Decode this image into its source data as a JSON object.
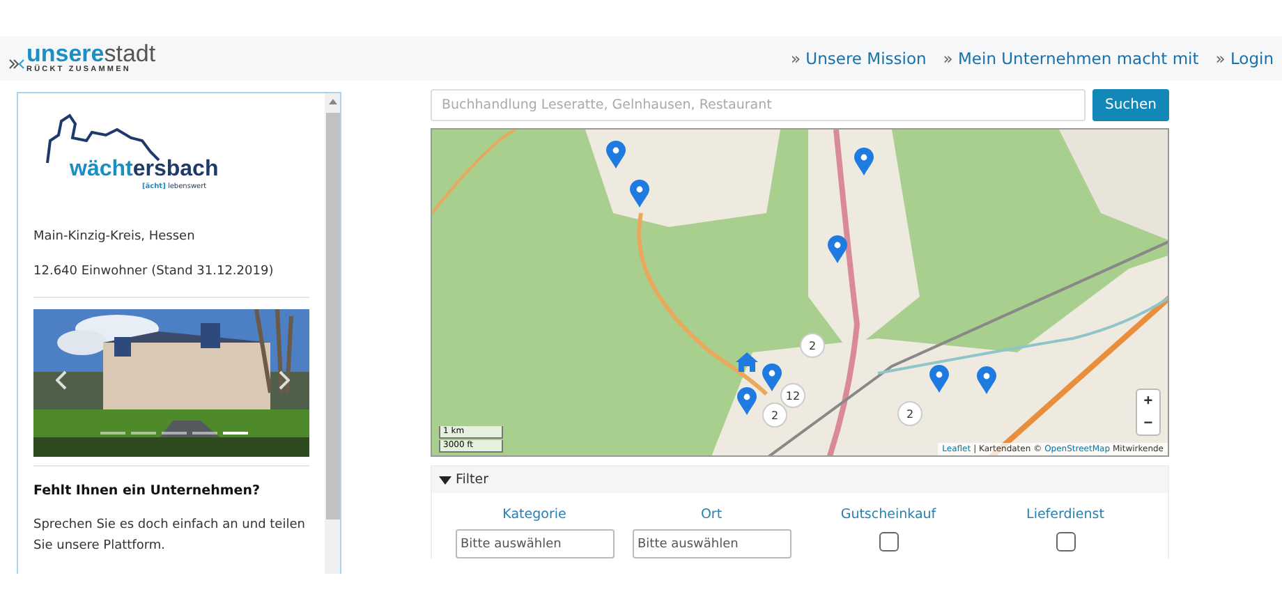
{
  "header": {
    "logo": {
      "brand_bold": "unsere",
      "brand_light": "stadt",
      "tagline": "RÜCKT ZUSAMMEN"
    },
    "nav": [
      {
        "prefix": "»",
        "label": "Unsere Mission"
      },
      {
        "prefix": "»",
        "label": "Mein Unternehmen macht mit"
      },
      {
        "prefix": "»",
        "label": "Login"
      }
    ]
  },
  "city_panel": {
    "logo": {
      "name_highlight": "wächt",
      "name_rest": "ersbach",
      "slogan_tag": "[ächt]",
      "slogan": "lebenswert"
    },
    "region": "Main-Kinzig-Kreis, Hessen",
    "population": "12.640 Einwohner (Stand 31.12.2019)",
    "carousel": {
      "slides": [
        {
          "selected": false
        },
        {
          "selected": false
        },
        {
          "selected": false
        },
        {
          "selected": false
        },
        {
          "selected": true
        }
      ]
    },
    "cta_title": "Fehlt Ihnen ein Unternehmen?",
    "cta_text": "Sprechen Sie es doch einfach an und teilen Sie unsere Plattform."
  },
  "search": {
    "placeholder": "Buchhandlung Leseratte, Gelnhausen, Restaurant",
    "button": "Suchen"
  },
  "map": {
    "clusters": [
      {
        "count": "2"
      },
      {
        "count": "12"
      },
      {
        "count": "2"
      },
      {
        "count": "2"
      }
    ],
    "zoom_in": "+",
    "zoom_out": "−",
    "scale": [
      "1 km",
      "3000 ft"
    ],
    "attribution": {
      "leaflet": "Leaflet",
      "data": "| Kartendaten ©",
      "osm": "OpenStreetMap",
      "rest": "Mitwirkende"
    }
  },
  "filter": {
    "title": "Filter",
    "expanded": true,
    "fields": [
      {
        "kind": "select",
        "label": "Kategorie",
        "placeholder": "Bitte auswählen"
      },
      {
        "kind": "select",
        "label": "Ort",
        "placeholder": "Bitte auswählen"
      },
      {
        "kind": "checkbox",
        "label": "Gutscheinkauf",
        "checked": false
      },
      {
        "kind": "checkbox",
        "label": "Lieferdienst",
        "checked": false
      }
    ]
  }
}
